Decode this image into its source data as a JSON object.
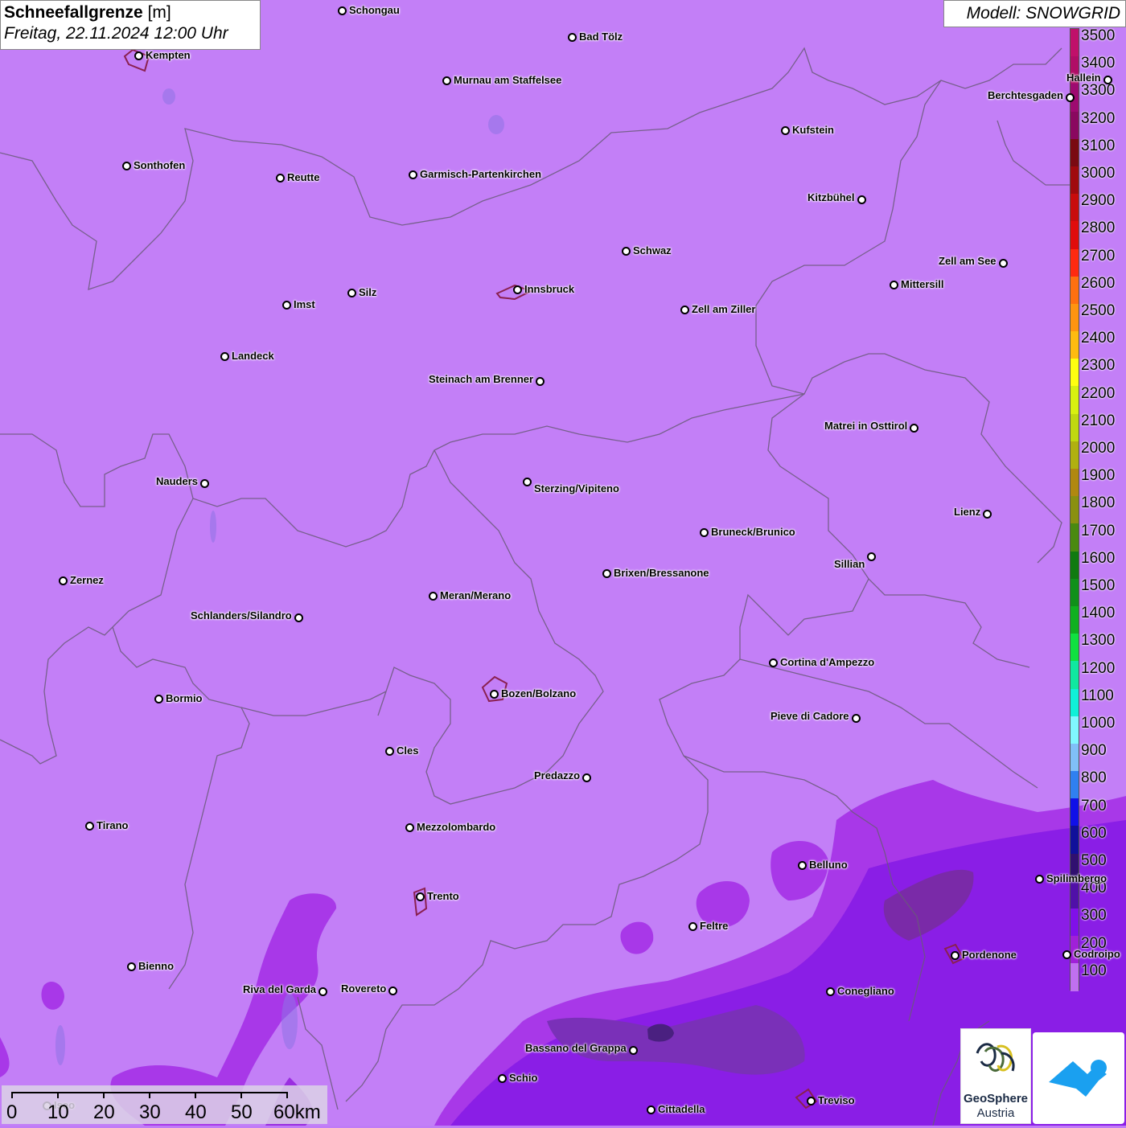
{
  "title": {
    "parameter": "Schneefallgrenze",
    "unit": "[m]",
    "datetime": "Freitag, 22.11.2024 12:00 Uhr"
  },
  "model": "Modell: SNOWGRID",
  "legend": {
    "levels": [
      {
        "label": "3500",
        "color": "#c0106a"
      },
      {
        "label": "3400",
        "color": "#b00d66"
      },
      {
        "label": "3300",
        "color": "#9e0a70"
      },
      {
        "label": "3200",
        "color": "#8a0860"
      },
      {
        "label": "3100",
        "color": "#7a0a12"
      },
      {
        "label": "3000",
        "color": "#a00a0e"
      },
      {
        "label": "2900",
        "color": "#c80c0c"
      },
      {
        "label": "2800",
        "color": "#e00c0c"
      },
      {
        "label": "2700",
        "color": "#ff2a10"
      },
      {
        "label": "2600",
        "color": "#ff7010"
      },
      {
        "label": "2500",
        "color": "#ff9410"
      },
      {
        "label": "2400",
        "color": "#ffbb10"
      },
      {
        "label": "2300",
        "color": "#ffff10"
      },
      {
        "label": "2200",
        "color": "#d8f010"
      },
      {
        "label": "2100",
        "color": "#c0d810"
      },
      {
        "label": "2000",
        "color": "#b0b010"
      },
      {
        "label": "1900",
        "color": "#b08810"
      },
      {
        "label": "1800",
        "color": "#8a9010"
      },
      {
        "label": "1700",
        "color": "#4a8a10"
      },
      {
        "label": "1600",
        "color": "#107a10"
      },
      {
        "label": "1500",
        "color": "#10901a"
      },
      {
        "label": "1400",
        "color": "#10b020"
      },
      {
        "label": "1300",
        "color": "#10e040"
      },
      {
        "label": "1200",
        "color": "#10e8a0"
      },
      {
        "label": "1100",
        "color": "#10f0d8"
      },
      {
        "label": "1000",
        "color": "#80f8ff"
      },
      {
        "label": "900",
        "color": "#80c0f8"
      },
      {
        "label": "800",
        "color": "#3080f0"
      },
      {
        "label": "700",
        "color": "#1010e8"
      },
      {
        "label": "600",
        "color": "#10109a"
      },
      {
        "label": "500",
        "color": "#301070"
      },
      {
        "label": "400",
        "color": "#5010a8"
      },
      {
        "label": "300",
        "color": "#8010e8"
      },
      {
        "label": "200",
        "color": "#a020d8"
      },
      {
        "label": "100",
        "color": "#c070f0"
      }
    ]
  },
  "cities": [
    {
      "name": "Schongau"
    },
    {
      "name": "Bad Tölz"
    },
    {
      "name": "Kempten"
    },
    {
      "name": "Murnau am Staffelsee"
    },
    {
      "name": "Hallein"
    },
    {
      "name": "Berchtesgaden"
    },
    {
      "name": "Kufstein"
    },
    {
      "name": "Sonthofen"
    },
    {
      "name": "Reutte"
    },
    {
      "name": "Garmisch-Partenkirchen"
    },
    {
      "name": "Kitzbühel"
    },
    {
      "name": "Schwaz"
    },
    {
      "name": "Zell am See"
    },
    {
      "name": "Mittersill"
    },
    {
      "name": "Innsbruck"
    },
    {
      "name": "Silz"
    },
    {
      "name": "Imst"
    },
    {
      "name": "Zell am Ziller"
    },
    {
      "name": "Landeck"
    },
    {
      "name": "Steinach am Brenner"
    },
    {
      "name": "Matrei in Osttirol"
    },
    {
      "name": "Nauders"
    },
    {
      "name": "Sterzing/Vipiteno"
    },
    {
      "name": "Lienz"
    },
    {
      "name": "Bruneck/Brunico"
    },
    {
      "name": "Sillian"
    },
    {
      "name": "Zernez"
    },
    {
      "name": "Brixen/Bressanone"
    },
    {
      "name": "Meran/Merano"
    },
    {
      "name": "Schlanders/Silandro"
    },
    {
      "name": "Cortina d'Ampezzo"
    },
    {
      "name": "Bozen/Bolzano"
    },
    {
      "name": "Bormio"
    },
    {
      "name": "Pieve di Cadore"
    },
    {
      "name": "Cles"
    },
    {
      "name": "Predazzo"
    },
    {
      "name": "Tirano"
    },
    {
      "name": "Mezzolombardo"
    },
    {
      "name": "Belluno"
    },
    {
      "name": "Spilimbergo"
    },
    {
      "name": "Trento"
    },
    {
      "name": "Feltre"
    },
    {
      "name": "Pordenone"
    },
    {
      "name": "Bienno"
    },
    {
      "name": "Riva del Garda"
    },
    {
      "name": "Rovereto"
    },
    {
      "name": "Conegliano"
    },
    {
      "name": "Bassano del Grappa"
    },
    {
      "name": "Schio"
    },
    {
      "name": "Treviso"
    },
    {
      "name": "Cittadella"
    },
    {
      "name": "Iseo"
    },
    {
      "name": "Codroipo"
    }
  ],
  "scalebar": {
    "labels": [
      "0",
      "10",
      "20",
      "30",
      "40",
      "50",
      "60km"
    ]
  },
  "logos": {
    "geosphere_line1": "GeoSphere",
    "geosphere_line2": "Austria"
  }
}
